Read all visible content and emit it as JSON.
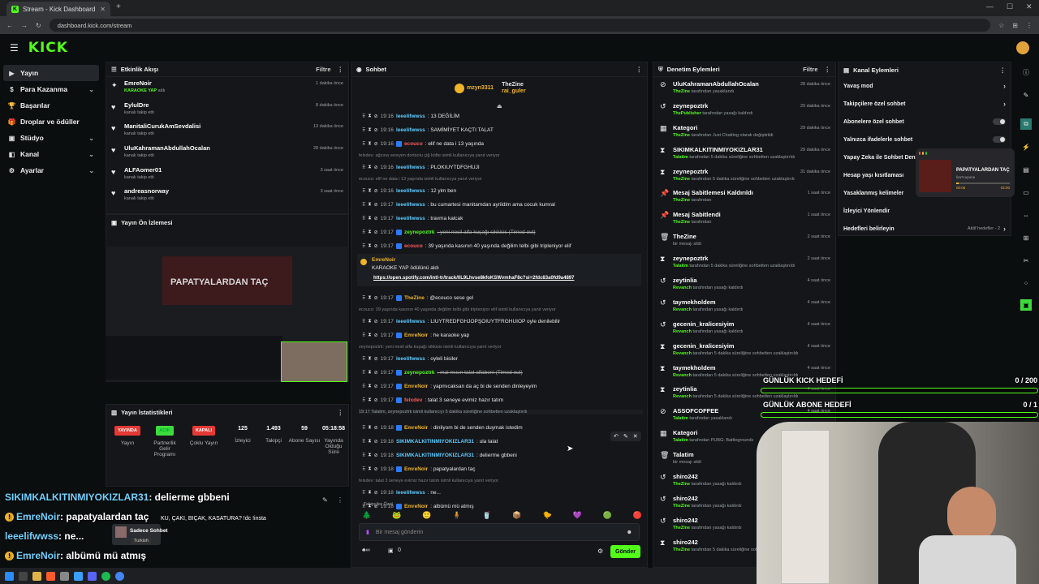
{
  "browser": {
    "tab_title": "Stream - Kick Dashboard",
    "url": "dashboard.kick.com/stream"
  },
  "kick": {
    "logo": "KICK"
  },
  "sidebar": {
    "items": [
      {
        "label": "Yayın",
        "icon": "video-icon",
        "active": true,
        "expandable": false
      },
      {
        "label": "Para Kazanma",
        "icon": "dollar-icon",
        "active": false,
        "expandable": true
      },
      {
        "label": "Başarılar",
        "icon": "trophy-icon",
        "active": false,
        "expandable": false
      },
      {
        "label": "Droplar ve ödüller",
        "icon": "gift-icon",
        "active": false,
        "expandable": false
      },
      {
        "label": "Stüdyo",
        "icon": "studio-icon",
        "active": false,
        "expandable": true
      },
      {
        "label": "Kanal",
        "icon": "channel-icon",
        "active": false,
        "expandable": true
      },
      {
        "label": "Ayarlar",
        "icon": "gear-icon",
        "active": false,
        "expandable": true
      }
    ]
  },
  "activity": {
    "title": "Etkinlik Akışı",
    "filter": "Filtre",
    "items": [
      {
        "name": "EmreNoir",
        "sub_em": "KARAOKE YAP",
        "sub": "aldı",
        "time": "1 dakika önce",
        "icon": "reward-icon"
      },
      {
        "name": "EylulDre",
        "sub": "kanalı takip etti",
        "time": "8 dakika önce",
        "icon": "heart-icon"
      },
      {
        "name": "ManitaliCurukAmSevdalisi",
        "sub": "kanalı takip etti",
        "time": "13 dakika önce",
        "icon": "heart-icon"
      },
      {
        "name": "UluKahramanAbdullahOcalan",
        "sub": "kanalı takip etti",
        "time": "28 dakika önce",
        "icon": "heart-icon"
      },
      {
        "name": "ALFAomer01",
        "sub": "kanalı takip etti",
        "time": "3 saat önce",
        "icon": "heart-icon"
      },
      {
        "name": "andreasnorway",
        "sub": "kanalı takip etti",
        "time": "3 saat önce",
        "icon": "heart-icon"
      }
    ]
  },
  "preview": {
    "title": "Yayın Ön İzlemesi",
    "video_text": "PAPATYALARDAN TAÇ"
  },
  "stats": {
    "title": "Yayın İstatistikleri",
    "items": [
      {
        "chip": "YAYINDA",
        "chip_color": "#e53935",
        "label": "Yayın"
      },
      {
        "chip": "ACIK",
        "chip_color": "#3ddc3d",
        "label": "Partnerlik Gelir Programı"
      },
      {
        "chip": "KAPALI",
        "chip_color": "#e53935",
        "label": "Çoklu Yayın"
      },
      {
        "value": "125",
        "label": "İzleyici"
      },
      {
        "value": "1.493",
        "label": "Takipçi"
      },
      {
        "value": "59",
        "label": "Abone Sayısı"
      },
      {
        "value": "05:18:58",
        "label": "Yayında Olduğu Süre"
      }
    ]
  },
  "overlay_chat": [
    {
      "user": "SIKIMKALKITINMIYOKIZLAR31",
      "text": ": delierme gbbeni",
      "badge": false
    },
    {
      "user": "EmreNoir",
      "text": ": papatyalardan taç",
      "badge": true
    },
    {
      "user": "leeelifwwss",
      "text": ": ne...",
      "badge": false
    },
    {
      "user": "EmreNoir",
      "text": ": albümü mü atmış",
      "badge": true
    }
  ],
  "overlay_misc": {
    "question": "KU, ÇAKI, BIÇAK, KASATURA? !dc !insta",
    "mode": "Sadece Sohbet",
    "lang": "Turkish"
  },
  "chat": {
    "title": "Sohbet",
    "top_user1": "mzyn3311",
    "top_user1_count": "2",
    "top_user2": "TheZine",
    "top_user2_count": "2",
    "top_user3": "rai_guler",
    "top_user3_count": "2",
    "messages": [
      {
        "time": "19:16",
        "user": "leeelifwwss",
        "uc": "",
        "text": ": 13 DEĞİLİM"
      },
      {
        "time": "19:16",
        "user": "leeelifwwss",
        "uc": "",
        "text": ": SAMİMİYET KAÇTI TALAT"
      },
      {
        "time": "19:16",
        "user": "ecouco",
        "uc": "r",
        "text": ": elif ne data i 13 yaşında"
      },
      {
        "reply": "felxdev: ağzına vereyim dortsolu çiğ köfte isimli kullanıcıya yanıt veriyor"
      },
      {
        "time": "19:16",
        "user": "leeelifwwss",
        "uc": "",
        "text": ": PLOKIUYTDFGHUJI"
      },
      {
        "reply": "ecouco: elif ne data i 13 yaşında isimli kullanıcıya yanıt veriyor"
      },
      {
        "time": "19:16",
        "user": "leeelifwwss",
        "uc": "",
        "text": ": 12 yim ben"
      },
      {
        "time": "19:17",
        "user": "leeelifwwss",
        "uc": "",
        "text": ": bu cumartesi manitamdan ayrildim ama cocuk kumral"
      },
      {
        "time": "19:17",
        "user": "leeelifwwss",
        "uc": "",
        "text": ": travma kalcak"
      },
      {
        "time": "19:17",
        "user": "zeynepoztrk",
        "uc": "g",
        "text": ": yeni nesil alfa kuşağı sikkisis (Timed out)"
      },
      {
        "time": "19:17",
        "user": "ecouco",
        "uc": "r",
        "text": ": 39 yaşında kasının 40 yaşında değilim telbi gibi tripleniyor elif"
      },
      {
        "redeem_user": "EmreNoir",
        "redeem_text": "KARAOKE YAP ödülünü aldı",
        "redeem_link": "https://open.spotify.com/intl-tr/track/0L9Lhvse8kfoKSWvmhaF8c?si=2fdc83a0fd9a4897"
      },
      {
        "time": "19:17",
        "user": "TheZine",
        "uc": "y",
        "text": ": @ecouco sese gel"
      },
      {
        "reply": "ecouco: 39 yaşında kasının 40 yaşında değilim telbi gibi tripleniyor elif isimli kullanıcıya yanıt veriyor"
      },
      {
        "time": "19:17",
        "user": "leeelifwwss",
        "uc": "",
        "text": ": LIUYTREDFGHJOPŞOIUYTFRGHUIOP oyle denilebilir"
      },
      {
        "time": "19:17",
        "user": "EmreNoir",
        "uc": "y",
        "text": ": he karaoke yap"
      },
      {
        "reply": "zeynepoztrk: yeni nesil alfa kuşağı sikkisis isimli kullanıcıya yanıt veriyor"
      },
      {
        "time": "19:17",
        "user": "leeelifwwss",
        "uc": "",
        "text": ": oyleli bisiler"
      },
      {
        "time": "19:17",
        "user": "zeynepoztrk",
        "uc": "g",
        "text": ": mal mısın talat alfabeni (Timed out)"
      },
      {
        "time": "19:17",
        "user": "EmreNoir",
        "uc": "y",
        "text": ": yapmıcaksan da aç bi de senden dinleyeyim"
      },
      {
        "time": "19:17",
        "user": "felxdev",
        "uc": "r",
        "text": ": talat 3 seneye evimiz hazır tatım"
      },
      {
        "system": "19:17  Talatim, zeynepoztrk isimli kullanıcıyı 5 dakika süreliğine sohbetten uzaklaştırdı"
      },
      {
        "time": "19:18",
        "user": "EmreNoir",
        "uc": "y",
        "text": ": dinliyom bi de senden duymak istedim"
      },
      {
        "time": "19:18",
        "user": "SIKIMKALKITINMIYOKIZLAR31",
        "uc": "",
        "text": ": ula talat"
      },
      {
        "time": "19:18",
        "user": "SIKIMKALKITINMIYOKIZLAR31",
        "uc": "",
        "text": ": delierme gbbeni"
      },
      {
        "time": "19:18",
        "user": "EmreNoir",
        "uc": "y",
        "text": ": papatyalardan taç"
      },
      {
        "reply": "felxdev: talat 3 seneye evimiz hazır tatım isimli kullanıcıya yanıt veriyor"
      },
      {
        "time": "19:18",
        "user": "leeelifwwss",
        "uc": "",
        "text": ": ne..."
      },
      {
        "time": "19:18",
        "user": "EmreNoir",
        "uc": "y",
        "text": ": albümü mü atmış"
      }
    ],
    "emote_label": "Takipçiler Özel",
    "input_placeholder": "Bir mesaj gönderin",
    "points": "0",
    "send": "Gönder"
  },
  "moderation": {
    "title": "Denetim Eylemleri",
    "filter": "Filtre",
    "items": [
      {
        "name": "UluKahramanAbdullahOcalan",
        "actor": "TheZine",
        "text": "tarafından yasaklandı",
        "time": "28 dakika önce",
        "icon": "ban-icon"
      },
      {
        "name": "zeynepoztrk",
        "actor": "ThePublisher",
        "text": "tarafından yasağı kaldırdı",
        "time": "29 dakika önce",
        "icon": "undo-icon"
      },
      {
        "name": "Kategori",
        "actor": "TheZine",
        "text": "tarafından Just Chatting olarak değiştirildi",
        "time": "29 dakika önce",
        "icon": "calendar-icon"
      },
      {
        "name": "SIKIMKALKITINMIYOKIZLAR31",
        "actor": "Talatim",
        "text": "tarafından 5 dakika süreliğine sohbetten uzaklaştırıldı",
        "time": "29 dakika önce",
        "icon": "hourglass-icon"
      },
      {
        "name": "zeynepoztrk",
        "actor": "TheZine",
        "text": "tarafından 5 dakika süreliğine sohbetten uzaklaştırıldı",
        "time": "31 dakika önce",
        "icon": "hourglass-icon"
      },
      {
        "name": "Mesaj Sabitlemesi Kaldırıldı",
        "actor": "TheZine",
        "text": "tarafından",
        "time": "1 saat önce",
        "icon": "pin-icon"
      },
      {
        "name": "Mesaj Sabitlendi",
        "actor": "TheZine",
        "text": "tarafından",
        "time": "1 saat önce",
        "icon": "pin-icon"
      },
      {
        "name": "TheZine",
        "actor": "",
        "text": "bir mesajı sildi",
        "time": "2 saat önce",
        "icon": "trash-icon"
      },
      {
        "name": "zeynepoztrk",
        "actor": "Talatim",
        "text": "tarafından 5 dakika süreliğine sohbetten uzaklaştırıldı",
        "time": "2 saat önce",
        "icon": "hourglass-icon"
      },
      {
        "name": "zeytinlia",
        "actor": "Revanch",
        "text": "tarafından yasağı kaldırdı",
        "time": "4 saat önce",
        "icon": "undo-icon"
      },
      {
        "name": "taymekholdem",
        "actor": "Revanch",
        "text": "tarafından yasağı kaldırdı",
        "time": "4 saat önce",
        "icon": "undo-icon"
      },
      {
        "name": "gecenin_kralicesiyim",
        "actor": "Revanch",
        "text": "tarafından yasağı kaldırdı",
        "time": "4 saat önce",
        "icon": "undo-icon"
      },
      {
        "name": "gecenin_kralicesiyim",
        "actor": "Revanch",
        "text": "tarafından 5 dakika süreliğine sohbetten uzaklaştırıldı",
        "time": "4 saat önce",
        "icon": "hourglass-icon"
      },
      {
        "name": "taymekholdem",
        "actor": "Revanch",
        "text": "tarafından 5 dakika süreliğine sohbetten uzaklaştırıldı",
        "time": "4 saat önce",
        "icon": "hourglass-icon"
      },
      {
        "name": "zeytinlia",
        "actor": "Revanch",
        "text": "tarafından 5 dakika süreliğine sohbetten uzaklaştırıldı",
        "time": "4 saat önce",
        "icon": "hourglass-icon"
      },
      {
        "name": "ASSOFCOFFEE",
        "actor": "Talatim",
        "text": "tarafından yasaklandı",
        "time": "4 saat önce",
        "icon": "ban-icon"
      },
      {
        "name": "Kategori",
        "actor": "Talatim",
        "text": "tarafından PUBG: Battlegrounds",
        "time": "",
        "icon": "calendar-icon"
      },
      {
        "name": "Talatim",
        "actor": "",
        "text": "bir mesajı sildi",
        "time": "",
        "icon": "trash-icon"
      },
      {
        "name": "shiro242",
        "actor": "TheZine",
        "text": "tarafından yasağı kaldırdı",
        "time": "",
        "icon": "undo-icon"
      },
      {
        "name": "shiro242",
        "actor": "TheZine",
        "text": "tarafından yasağı kaldırdı",
        "time": "",
        "icon": "undo-icon"
      },
      {
        "name": "shiro242",
        "actor": "TheZine",
        "text": "tarafından yasağı kaldırdı",
        "time": "",
        "icon": "undo-icon"
      },
      {
        "name": "shiro242",
        "actor": "TheZine",
        "text": "tarafından 5 dakika süreliğine sohbetten uzaklaştırıldı",
        "time": "",
        "icon": "hourglass-icon"
      }
    ]
  },
  "channel_actions": {
    "title": "Kanal Eylemleri",
    "items": [
      {
        "label": "Yavaş mod",
        "control": "chevron"
      },
      {
        "label": "Takipçilere özel sohbet",
        "control": "chevron"
      },
      {
        "label": "Abonelere özel sohbet",
        "control": "toggle"
      },
      {
        "label": "Yalnızca ifadelerle sohbet",
        "control": "toggle"
      },
      {
        "label": "Yapay Zeka ile Sohbet Den",
        "control": ""
      },
      {
        "label": "Hesap yaşı kısıtlaması",
        "control": ""
      },
      {
        "label": "Yasaklanmış kelimeler",
        "control": ""
      },
      {
        "label": "İzleyici Yönlendir",
        "control": ""
      },
      {
        "label": "Hedefleri belirleyin",
        "control": "chevron",
        "extra": "Aktif hedefler - 2"
      }
    ]
  },
  "spotify": {
    "title": "PAPATYALARDAN TAÇ",
    "artist": "lira?copone",
    "elapsed": "00:06",
    "total": "02:00"
  },
  "goals": [
    {
      "label": "GÜNLÜK KICK HEDEFİ",
      "value": "0 / 200",
      "progress": 0
    },
    {
      "label": "GÜNLÜK ABONE HEDEFİ",
      "value": "0 / 1",
      "progress": 0
    }
  ]
}
